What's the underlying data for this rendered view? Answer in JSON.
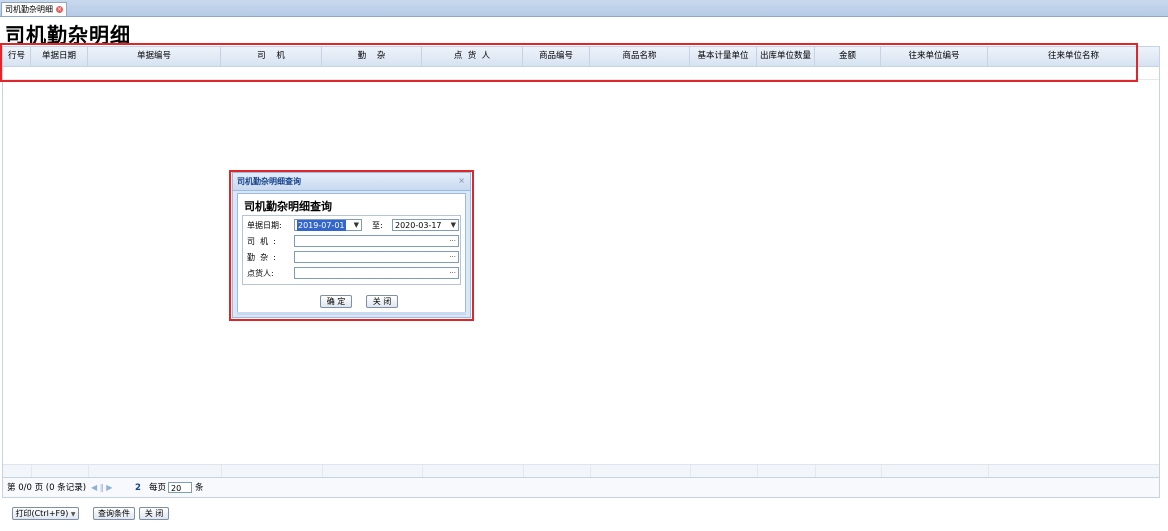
{
  "tab": {
    "label": "司机勤杂明细",
    "close_icon": "close-icon"
  },
  "page_title": "司机勤杂明细",
  "grid": {
    "columns": [
      "行号",
      "单据日期",
      "单据编号",
      "司    机",
      "勤    杂",
      "点  货  人",
      "商品编号",
      "商品名称",
      "基本计量单位",
      "出库单位数量",
      "金额",
      "往来单位编号",
      "往来单位名称"
    ]
  },
  "pager": {
    "page_info": "第  0/0 页  (0 条记录)",
    "nav_icons": "◀ ‖ ▶",
    "page_num": "2",
    "per_page_label": "每页",
    "per_page_value": "20",
    "per_page_suffix": "条"
  },
  "bottom_buttons": {
    "print": "打印(Ctrl+F9)",
    "print_arrow": "▼",
    "query": "查询条件",
    "close": "关 闭"
  },
  "dialog": {
    "title": "司机勤杂明细查询",
    "close_icon": "⨯",
    "heading": "司机勤杂明细查询",
    "date_label": "单据日期:",
    "date_from": "2019-07-01",
    "to_label": "至:",
    "date_to": "2020-03-17",
    "driver_label": "司  机  :",
    "chores_label": "勤  杂  :",
    "checker_label": "点货人:",
    "ellipsis": "···",
    "dropdown_icon": "▼",
    "ok_button": "确 定",
    "close_button": "关 闭"
  },
  "colors": {
    "annotation": "#e0262b",
    "header": "#d7e3f2",
    "dialog_title": "#15428b"
  }
}
